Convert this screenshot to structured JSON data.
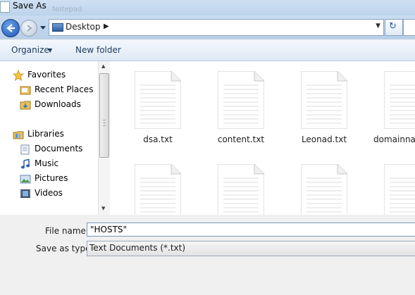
{
  "window": {
    "title": "Save As",
    "ghost_title": "Notepad"
  },
  "address": {
    "location": "Desktop",
    "separator": "▶",
    "dropdown": "▼"
  },
  "toolbar": {
    "organize_label": "Organize",
    "organize_arrow": "▼",
    "new_folder_label": "New folder"
  },
  "nav": {
    "items": [
      {
        "label": "Favorites",
        "icon": "star-icon"
      },
      {
        "label": "Recent Places",
        "icon": "recent-places-icon"
      },
      {
        "label": "Downloads",
        "icon": "downloads-folder-icon"
      },
      {
        "label": "Libraries",
        "icon": "libraries-icon"
      },
      {
        "label": "Documents",
        "icon": "documents-icon"
      },
      {
        "label": "Music",
        "icon": "music-icon"
      },
      {
        "label": "Pictures",
        "icon": "pictures-icon"
      },
      {
        "label": "Videos",
        "icon": "videos-icon"
      }
    ]
  },
  "files": [
    {
      "name": "dsa.txt"
    },
    {
      "name": "content.txt"
    },
    {
      "name": "Leonad.txt"
    },
    {
      "name": "domainname"
    },
    {
      "name": ""
    },
    {
      "name": ""
    },
    {
      "name": ""
    },
    {
      "name": ""
    }
  ],
  "form": {
    "filename_label": "File name:",
    "filename_value": "\"HOSTS\"",
    "type_label": "Save as type:",
    "type_value": "Text Documents (*.txt)"
  },
  "colors": {
    "accent": "#1d56b4",
    "toolbar_text": "#1e395b"
  }
}
